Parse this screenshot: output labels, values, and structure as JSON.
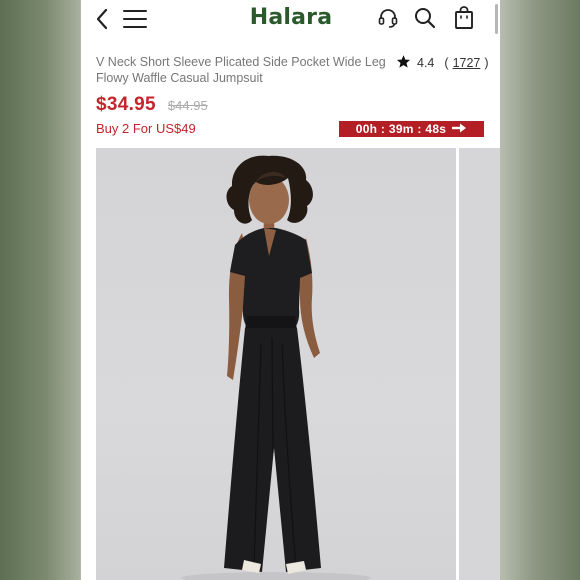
{
  "header": {
    "brand": "Halara",
    "icons": [
      "back-icon",
      "menu-icon",
      "headset-icon",
      "search-icon",
      "bag-icon"
    ]
  },
  "product": {
    "title": "V Neck Short Sleeve Plicated Side Pocket Wide Leg Flowy Waffle Casual Jumpsuit",
    "rating": "4.4",
    "review_open": "(",
    "review_count": "1727",
    "review_close": ")",
    "price": "$34.95",
    "original_price": "$44.95",
    "promo": "Buy 2 For US$49",
    "countdown": "00h : 39m : 48s"
  },
  "colors": {
    "brand": "#2a5a2c",
    "price": "#c4242b",
    "timer_bg": "#b41f25"
  }
}
